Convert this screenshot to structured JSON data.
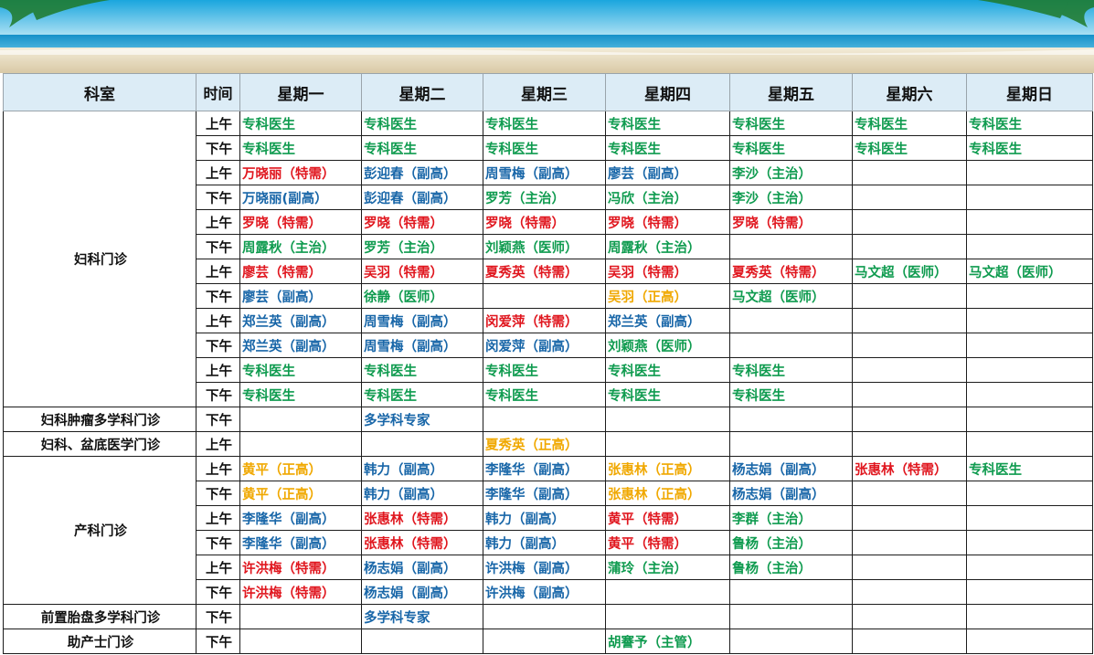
{
  "header": {
    "dept": "科室",
    "time": "时间",
    "days": [
      "星期一",
      "星期二",
      "星期三",
      "星期四",
      "星期五",
      "星期六",
      "星期日"
    ]
  },
  "colors": {
    "specialist": "#0f9b4f",
    "doctor": "#1866a8",
    "special_need": "#e0161e",
    "chief": "#f0a800"
  },
  "groups": [
    {
      "dept": "妇科门诊",
      "rows": [
        {
          "time": "上午",
          "cells": [
            [
              "专科医生",
              "green"
            ],
            [
              "专科医生",
              "green"
            ],
            [
              "专科医生",
              "green"
            ],
            [
              "专科医生",
              "green"
            ],
            [
              "专科医生",
              "green"
            ],
            [
              "专科医生",
              "green"
            ],
            [
              "专科医生",
              "green"
            ]
          ]
        },
        {
          "time": "下午",
          "cells": [
            [
              "专科医生",
              "green"
            ],
            [
              "专科医生",
              "green"
            ],
            [
              "专科医生",
              "green"
            ],
            [
              "专科医生",
              "green"
            ],
            [
              "专科医生",
              "green"
            ],
            [
              "专科医生",
              "green"
            ],
            [
              "专科医生",
              "green"
            ]
          ]
        },
        {
          "time": "上午",
          "cells": [
            [
              "万晓丽（特需）",
              "red"
            ],
            [
              "彭迎春（副高）",
              "blue"
            ],
            [
              "周雪梅（副高）",
              "blue"
            ],
            [
              "廖芸（副高）",
              "blue"
            ],
            [
              "李沙（主治）",
              "green"
            ],
            [
              "",
              ""
            ],
            [
              "",
              ""
            ]
          ]
        },
        {
          "time": "下午",
          "cells": [
            [
              "万晓丽(副高）",
              "blue"
            ],
            [
              "彭迎春（副高）",
              "blue"
            ],
            [
              "罗芳（主治）",
              "green"
            ],
            [
              "冯欣（主治）",
              "green"
            ],
            [
              "李沙（主治）",
              "green"
            ],
            [
              "",
              ""
            ],
            [
              "",
              ""
            ]
          ]
        },
        {
          "time": "上午",
          "cells": [
            [
              "罗晓（特需）",
              "red"
            ],
            [
              "罗晓（特需）",
              "red"
            ],
            [
              "罗晓（特需）",
              "red"
            ],
            [
              "罗晓（特需）",
              "red"
            ],
            [
              "罗晓（特需）",
              "red"
            ],
            [
              "",
              ""
            ],
            [
              "",
              ""
            ]
          ]
        },
        {
          "time": "下午",
          "cells": [
            [
              "周露秋（主治）",
              "green"
            ],
            [
              "罗芳（主治）",
              "green"
            ],
            [
              "刘颖燕（医师）",
              "green"
            ],
            [
              "周露秋（主治）",
              "green"
            ],
            [
              "",
              ""
            ],
            [
              "",
              ""
            ],
            [
              "",
              ""
            ]
          ]
        },
        {
          "time": "上午",
          "cells": [
            [
              "廖芸（特需）",
              "red"
            ],
            [
              "吴羽（特需）",
              "red"
            ],
            [
              "夏秀英（特需）",
              "red"
            ],
            [
              "吴羽（特需）",
              "red"
            ],
            [
              "夏秀英（特需）",
              "red"
            ],
            [
              "马文超（医师）",
              "green"
            ],
            [
              "马文超（医师）",
              "green"
            ]
          ]
        },
        {
          "time": "下午",
          "cells": [
            [
              "廖芸（副高）",
              "blue"
            ],
            [
              "徐静（医师）",
              "green"
            ],
            [
              "",
              ""
            ],
            [
              "吴羽（正高）",
              "orange"
            ],
            [
              "马文超（医师）",
              "green"
            ],
            [
              "",
              ""
            ],
            [
              "",
              ""
            ]
          ]
        },
        {
          "time": "上午",
          "cells": [
            [
              "郑兰英（副高）",
              "blue"
            ],
            [
              "周雪梅（副高）",
              "blue"
            ],
            [
              "闵爱萍（特需）",
              "red"
            ],
            [
              "郑兰英（副高）",
              "blue"
            ],
            [
              "",
              ""
            ],
            [
              "",
              ""
            ],
            [
              "",
              ""
            ]
          ]
        },
        {
          "time": "下午",
          "cells": [
            [
              "郑兰英（副高）",
              "blue"
            ],
            [
              "周雪梅（副高）",
              "blue"
            ],
            [
              "闵爱萍（副高）",
              "blue"
            ],
            [
              "刘颖燕（医师）",
              "green"
            ],
            [
              "",
              ""
            ],
            [
              "",
              ""
            ],
            [
              "",
              ""
            ]
          ]
        },
        {
          "time": "上午",
          "cells": [
            [
              "专科医生",
              "green"
            ],
            [
              "专科医生",
              "green"
            ],
            [
              "专科医生",
              "green"
            ],
            [
              "专科医生",
              "green"
            ],
            [
              "专科医生",
              "green"
            ],
            [
              "",
              ""
            ],
            [
              "",
              ""
            ]
          ]
        },
        {
          "time": "下午",
          "cells": [
            [
              "专科医生",
              "green"
            ],
            [
              "专科医生",
              "green"
            ],
            [
              "专科医生",
              "green"
            ],
            [
              "专科医生",
              "green"
            ],
            [
              "专科医生",
              "green"
            ],
            [
              "",
              ""
            ],
            [
              "",
              ""
            ]
          ]
        }
      ]
    },
    {
      "dept": "妇科肿瘤多学科门诊",
      "rows": [
        {
          "time": "下午",
          "cells": [
            [
              "",
              ""
            ],
            [
              "多学科专家",
              "blue"
            ],
            [
              "",
              ""
            ],
            [
              "",
              ""
            ],
            [
              "",
              ""
            ],
            [
              "",
              ""
            ],
            [
              "",
              ""
            ]
          ]
        }
      ]
    },
    {
      "dept": "妇科、盆底医学门诊",
      "rows": [
        {
          "time": "上午",
          "cells": [
            [
              "",
              ""
            ],
            [
              "",
              ""
            ],
            [
              "夏秀英（正高）",
              "orange"
            ],
            [
              "",
              ""
            ],
            [
              "",
              ""
            ],
            [
              "",
              ""
            ],
            [
              "",
              ""
            ]
          ]
        }
      ]
    },
    {
      "dept": "产科门诊",
      "rows": [
        {
          "time": "上午",
          "cells": [
            [
              "黄平（正高）",
              "orange"
            ],
            [
              "韩力（副高）",
              "blue"
            ],
            [
              "李隆华（副高）",
              "blue"
            ],
            [
              "张惠林（正高）",
              "orange"
            ],
            [
              "杨志娟（副高）",
              "blue"
            ],
            [
              "张惠林（特需）",
              "red"
            ],
            [
              "专科医生",
              "green"
            ]
          ]
        },
        {
          "time": "下午",
          "cells": [
            [
              "黄平（正高）",
              "orange"
            ],
            [
              "韩力（副高）",
              "blue"
            ],
            [
              "李隆华（副高）",
              "blue"
            ],
            [
              "张惠林（正高）",
              "orange"
            ],
            [
              "杨志娟（副高）",
              "blue"
            ],
            [
              "",
              ""
            ],
            [
              "",
              ""
            ]
          ]
        },
        {
          "time": "上午",
          "cells": [
            [
              "李隆华（副高）",
              "blue"
            ],
            [
              "张惠林（特需）",
              "red"
            ],
            [
              "韩力（副高）",
              "blue"
            ],
            [
              "黄平（特需）",
              "red"
            ],
            [
              "李群（主治）",
              "green"
            ],
            [
              "",
              ""
            ],
            [
              "",
              ""
            ]
          ]
        },
        {
          "time": "下午",
          "cells": [
            [
              "李隆华（副高）",
              "blue"
            ],
            [
              "张惠林（特需）",
              "red"
            ],
            [
              "韩力（副高）",
              "blue"
            ],
            [
              "黄平（特需）",
              "red"
            ],
            [
              "鲁杨（主治）",
              "green"
            ],
            [
              "",
              ""
            ],
            [
              "",
              ""
            ]
          ]
        },
        {
          "time": "上午",
          "cells": [
            [
              "许洪梅（特需）",
              "red"
            ],
            [
              "杨志娟（副高）",
              "blue"
            ],
            [
              "许洪梅（副高）",
              "blue"
            ],
            [
              "蒲玲（主治）",
              "green"
            ],
            [
              "鲁杨（主治）",
              "green"
            ],
            [
              "",
              ""
            ],
            [
              "",
              ""
            ]
          ]
        },
        {
          "time": "下午",
          "cells": [
            [
              "许洪梅（特需）",
              "red"
            ],
            [
              "杨志娟（副高）",
              "blue"
            ],
            [
              "许洪梅（副高）",
              "blue"
            ],
            [
              "",
              ""
            ],
            [
              "",
              ""
            ],
            [
              "",
              ""
            ],
            [
              "",
              ""
            ]
          ]
        }
      ]
    },
    {
      "dept": "前置胎盘多学科门诊",
      "rows": [
        {
          "time": "下午",
          "cells": [
            [
              "",
              ""
            ],
            [
              "多学科专家",
              "blue"
            ],
            [
              "",
              ""
            ],
            [
              "",
              ""
            ],
            [
              "",
              ""
            ],
            [
              "",
              ""
            ],
            [
              "",
              ""
            ]
          ]
        }
      ]
    },
    {
      "dept": "助产士门诊",
      "rows": [
        {
          "time": "下午",
          "cells": [
            [
              "",
              ""
            ],
            [
              "",
              ""
            ],
            [
              "",
              ""
            ],
            [
              "胡謇予（主管）",
              "green"
            ],
            [
              "",
              ""
            ],
            [
              "",
              ""
            ],
            [
              "",
              ""
            ]
          ]
        }
      ]
    }
  ]
}
